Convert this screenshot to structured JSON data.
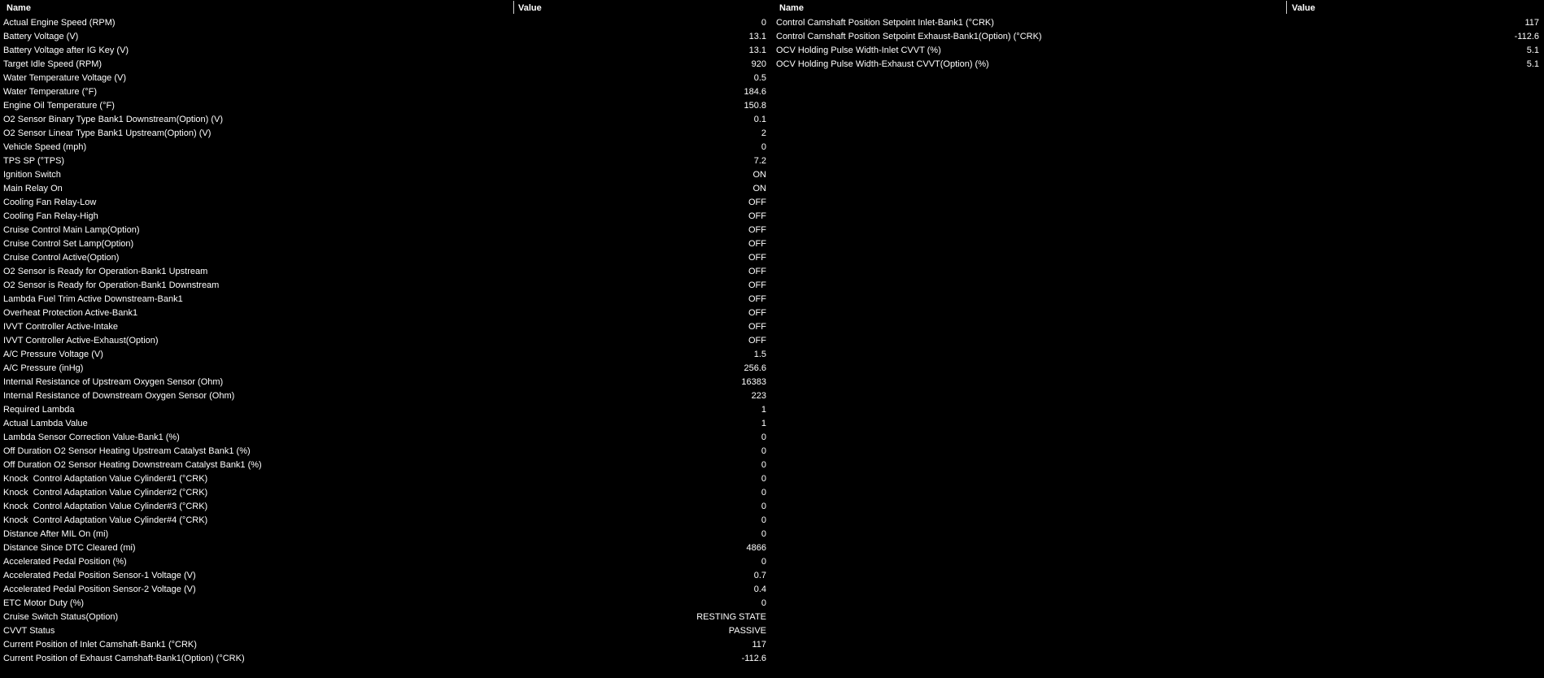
{
  "left_table": {
    "header_name": "Name",
    "header_value": "Value",
    "rows": [
      {
        "name": "Actual Engine Speed (RPM)",
        "value": "0"
      },
      {
        "name": "Battery Voltage (V)",
        "value": "13.1"
      },
      {
        "name": "Battery Voltage after IG Key (V)",
        "value": "13.1"
      },
      {
        "name": "Target Idle Speed (RPM)",
        "value": "920"
      },
      {
        "name": "Water Temperature Voltage (V)",
        "value": "0.5"
      },
      {
        "name": "Water Temperature (°F)",
        "value": "184.6"
      },
      {
        "name": "Engine Oil Temperature (°F)",
        "value": "150.8"
      },
      {
        "name": "O2 Sensor Binary Type Bank1 Downstream(Option) (V)",
        "value": "0.1"
      },
      {
        "name": "O2 Sensor Linear Type Bank1 Upstream(Option) (V)",
        "value": "2"
      },
      {
        "name": "Vehicle Speed (mph)",
        "value": "0"
      },
      {
        "name": "TPS SP (°TPS)",
        "value": "7.2"
      },
      {
        "name": "Ignition Switch",
        "value": "ON"
      },
      {
        "name": "Main Relay On",
        "value": "ON"
      },
      {
        "name": "Cooling Fan Relay-Low",
        "value": "OFF"
      },
      {
        "name": "Cooling Fan Relay-High",
        "value": "OFF"
      },
      {
        "name": "Cruise Control Main Lamp(Option)",
        "value": "OFF"
      },
      {
        "name": "Cruise Control Set Lamp(Option)",
        "value": "OFF"
      },
      {
        "name": "Cruise Control Active(Option)",
        "value": "OFF"
      },
      {
        "name": "O2 Sensor is Ready for Operation-Bank1 Upstream",
        "value": "OFF"
      },
      {
        "name": "O2 Sensor is Ready for Operation-Bank1 Downstream",
        "value": "OFF"
      },
      {
        "name": "Lambda Fuel Trim Active Downstream-Bank1",
        "value": "OFF"
      },
      {
        "name": "Overheat Protection Active-Bank1",
        "value": "OFF"
      },
      {
        "name": "IVVT Controller Active-Intake",
        "value": "OFF"
      },
      {
        "name": "IVVT Controller Active-Exhaust(Option)",
        "value": "OFF"
      },
      {
        "name": "A/C Pressure Voltage (V)",
        "value": "1.5"
      },
      {
        "name": "A/C Pressure (inHg)",
        "value": "256.6"
      },
      {
        "name": "Internal Resistance of Upstream Oxygen Sensor (Ohm)",
        "value": "16383"
      },
      {
        "name": "Internal Resistance of Downstream Oxygen Sensor (Ohm)",
        "value": "223"
      },
      {
        "name": "Required Lambda",
        "value": "1"
      },
      {
        "name": "Actual Lambda Value",
        "value": "1"
      },
      {
        "name": "Lambda Sensor Correction Value-Bank1 (%)",
        "value": "0"
      },
      {
        "name": "Off Duration O2 Sensor Heating Upstream Catalyst Bank1 (%)",
        "value": "0"
      },
      {
        "name": "Off Duration O2 Sensor Heating Downstream Catalyst Bank1 (%)",
        "value": "0"
      },
      {
        "name": "Knock  Control Adaptation Value Cylinder#1 (°CRK)",
        "value": "0"
      },
      {
        "name": "Knock  Control Adaptation Value Cylinder#2 (°CRK)",
        "value": "0"
      },
      {
        "name": "Knock  Control Adaptation Value Cylinder#3 (°CRK)",
        "value": "0"
      },
      {
        "name": "Knock  Control Adaptation Value Cylinder#4 (°CRK)",
        "value": "0"
      },
      {
        "name": "Distance After MIL On (mi)",
        "value": "0"
      },
      {
        "name": "Distance Since DTC Cleared (mi)",
        "value": "4866"
      },
      {
        "name": "Accelerated Pedal Position (%)",
        "value": "0"
      },
      {
        "name": "Accelerated Pedal Position Sensor-1 Voltage (V)",
        "value": "0.7"
      },
      {
        "name": "Accelerated Pedal Position Sensor-2 Voltage (V)",
        "value": "0.4"
      },
      {
        "name": "ETC Motor Duty (%)",
        "value": "0"
      },
      {
        "name": "Cruise Switch Status(Option)",
        "value": "RESTING STATE"
      },
      {
        "name": "CVVT Status",
        "value": "PASSIVE"
      },
      {
        "name": "Current Position of Inlet Camshaft-Bank1 (°CRK)",
        "value": "117"
      },
      {
        "name": "Current Position of Exhaust Camshaft-Bank1(Option) (°CRK)",
        "value": "-112.6"
      }
    ]
  },
  "right_table": {
    "header_name": "Name",
    "header_value": "Value",
    "rows": [
      {
        "name": "Control Camshaft Position Setpoint Inlet-Bank1 (°CRK)",
        "value": "117"
      },
      {
        "name": "Control Camshaft Position Setpoint Exhaust-Bank1(Option) (°CRK)",
        "value": "-112.6"
      },
      {
        "name": "OCV Holding Pulse Width-Inlet CVVT (%)",
        "value": "5.1"
      },
      {
        "name": "OCV Holding Pulse Width-Exhaust CVVT(Option) (%)",
        "value": "5.1"
      }
    ]
  }
}
